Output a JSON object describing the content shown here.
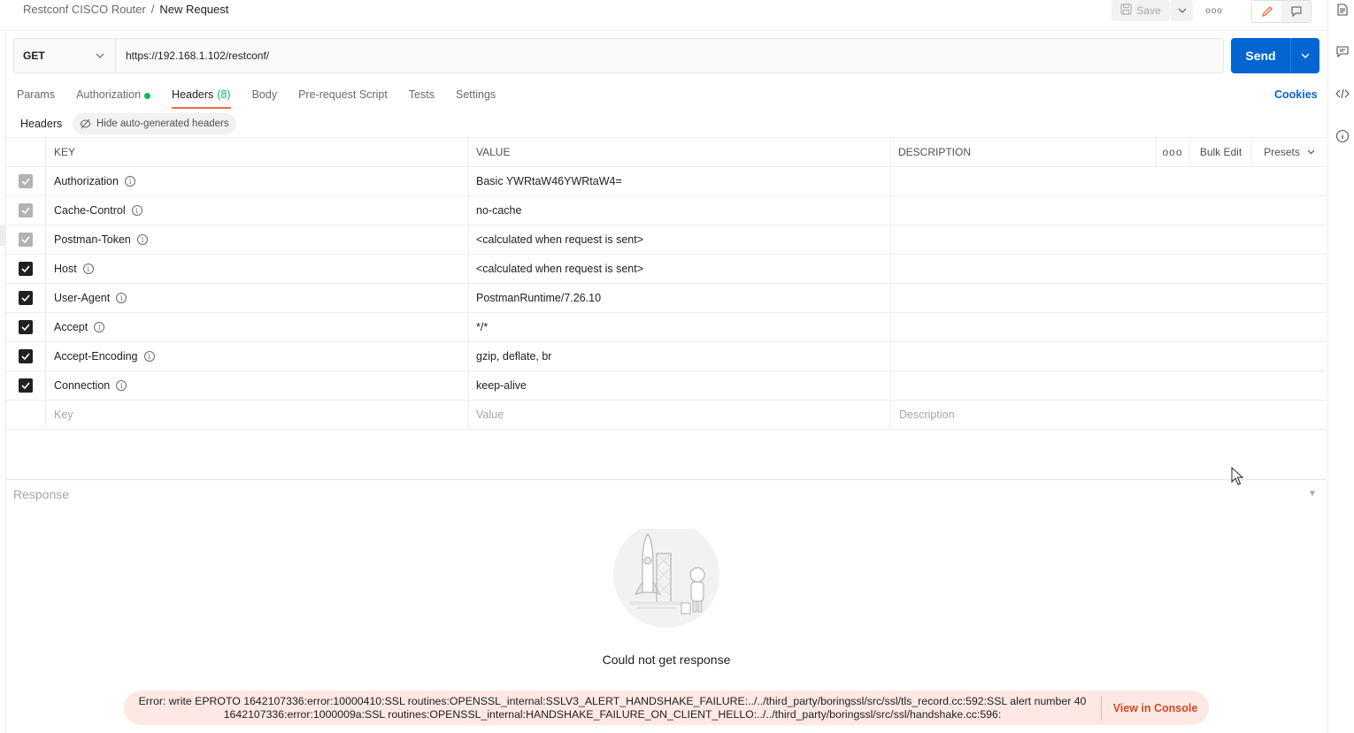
{
  "breadcrumb": {
    "parent": "Restconf CISCO Router",
    "separator": "/",
    "current": "New Request"
  },
  "toolbar": {
    "save_label": "Save",
    "more_label": "ooo"
  },
  "request": {
    "method": "GET",
    "url": "https://192.168.1.102/restconf/",
    "send_label": "Send"
  },
  "tabs": [
    {
      "label": "Params"
    },
    {
      "label": "Authorization"
    },
    {
      "label": "Headers",
      "count": "(8)"
    },
    {
      "label": "Body"
    },
    {
      "label": "Pre-request Script"
    },
    {
      "label": "Tests"
    },
    {
      "label": "Settings"
    }
  ],
  "cookies_label": "Cookies",
  "headers_section": {
    "title": "Headers",
    "hide_auto_label": "Hide auto-generated headers"
  },
  "table": {
    "columns": {
      "key": "KEY",
      "value": "VALUE",
      "description": "DESCRIPTION",
      "more": "ooo",
      "bulk_edit": "Bulk Edit",
      "presets": "Presets"
    },
    "rows": [
      {
        "key": "Authorization",
        "value": "Basic YWRtaW46YWRtaW4=",
        "checked": true,
        "disabled": true
      },
      {
        "key": "Cache-Control",
        "value": "no-cache",
        "checked": true,
        "disabled": true
      },
      {
        "key": "Postman-Token",
        "value": "<calculated when request is sent>",
        "checked": true,
        "disabled": true
      },
      {
        "key": "Host",
        "value": "<calculated when request is sent>",
        "checked": true,
        "disabled": false
      },
      {
        "key": "User-Agent",
        "value": "PostmanRuntime/7.26.10",
        "checked": true,
        "disabled": false
      },
      {
        "key": "Accept",
        "value": "*/*",
        "checked": true,
        "disabled": false
      },
      {
        "key": "Accept-Encoding",
        "value": "gzip, deflate, br",
        "checked": true,
        "disabled": false
      },
      {
        "key": "Connection",
        "value": "keep-alive",
        "checked": true,
        "disabled": false
      }
    ],
    "new_row": {
      "key_placeholder": "Key",
      "value_placeholder": "Value",
      "description_placeholder": "Description"
    }
  },
  "response": {
    "title": "Response",
    "empty_message": "Could not get response",
    "error_line1": "Error: write EPROTO 1642107336:error:10000410:SSL routines:OPENSSL_internal:SSLV3_ALERT_HANDSHAKE_FAILURE:../../third_party/boringssl/src/ssl/tls_record.cc:592:SSL alert number 40",
    "error_line2": "1642107336:error:1000009a:SSL routines:OPENSSL_internal:HANDSHAKE_FAILURE_ON_CLIENT_HELLO:../../third_party/boringssl/src/ssl/handshake.cc:596:",
    "view_console_label": "View in Console"
  },
  "colors": {
    "accent": "#0265d2",
    "tab_underline": "#f26b3a",
    "success": "#0cbb52",
    "error_bg": "#fde8e4",
    "error_link": "#d04b25"
  }
}
